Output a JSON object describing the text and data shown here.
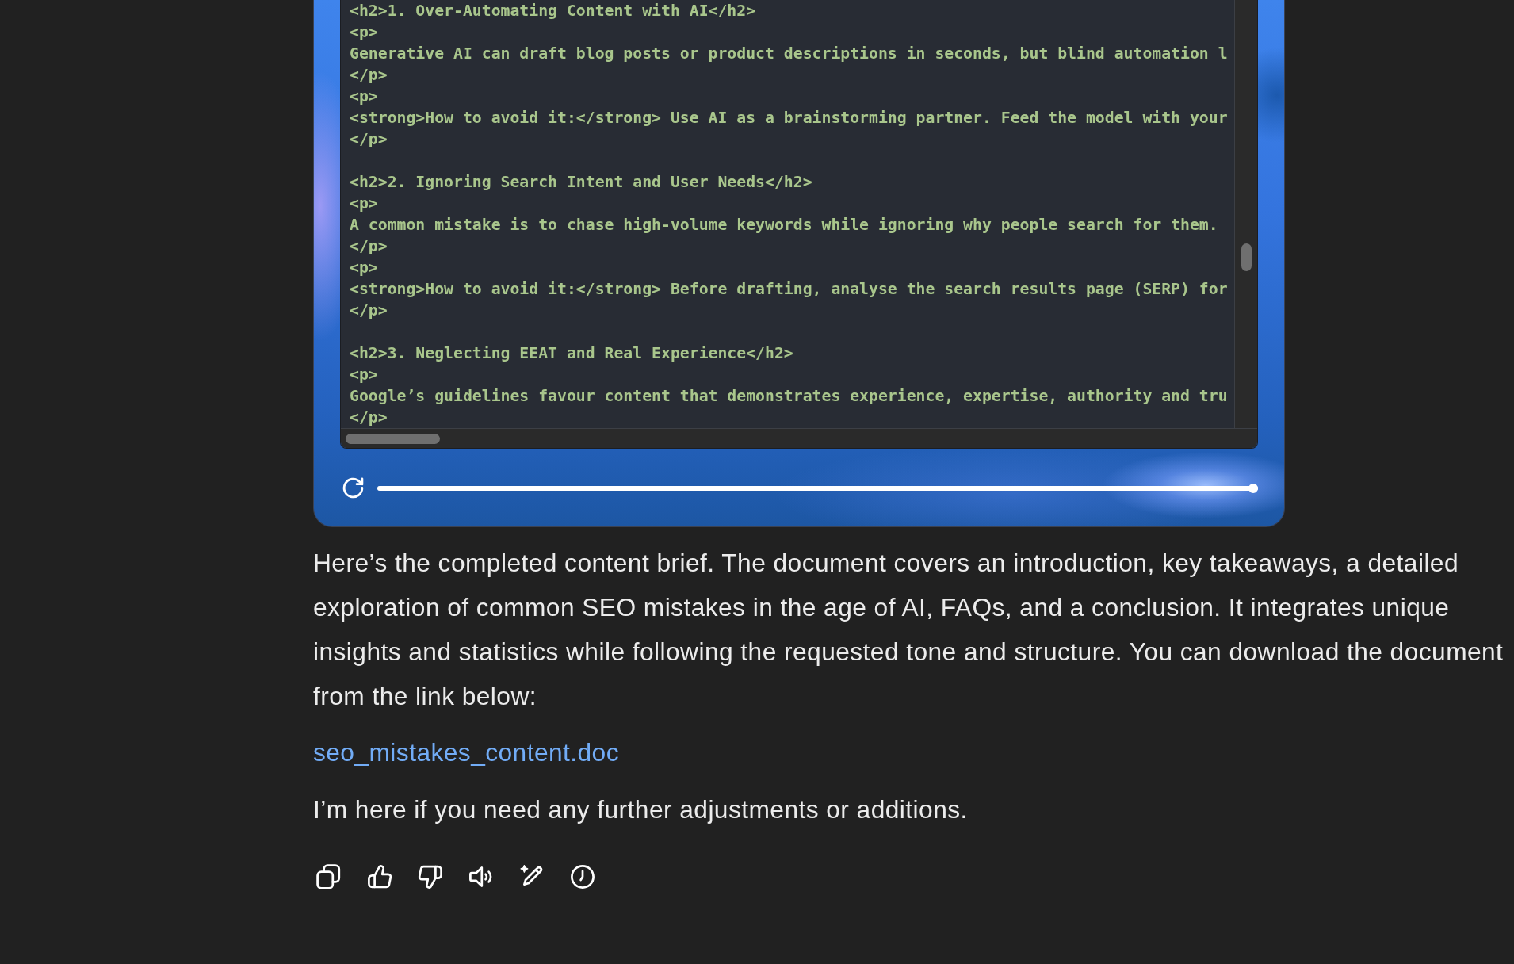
{
  "code_viewer": {
    "blocks": [
      {
        "lines": [
          "<h2>1. Over-Automating Content with AI</h2>",
          "<p>",
          "Generative AI can draft blog posts or product descriptions in seconds, but blind automation l",
          "</p>",
          "<p>",
          "<strong>How to avoid it:</strong> Use AI as a brainstorming partner. Feed the model with your",
          "</p>"
        ]
      },
      {
        "lines": [
          "<h2>2. Ignoring Search Intent and User Needs</h2>",
          "<p>",
          "A common mistake is to chase high-volume keywords while ignoring why people search for them.",
          "</p>",
          "<p>",
          "<strong>How to avoid it:</strong> Before drafting, analyse the search results page (SERP) for",
          "</p>"
        ]
      },
      {
        "lines": [
          "<h2>3. Neglecting EEAT and Real Experience</h2>",
          "<p>",
          "Google’s guidelines favour content that demonstrates experience, expertise, authority and tru",
          "</p>"
        ]
      }
    ]
  },
  "player": {
    "level": 1
  },
  "message": {
    "paragraph_lines": [
      "Here’s the completed content brief. The document covers an introduction, key takeaways, a detailed",
      "exploration of common SEO mistakes in the age of AI, FAQs, and a conclusion. It integrates unique",
      "insights and statistics while following the requested tone and structure. You can download the document",
      "from the link below:"
    ],
    "link": "seo_mistakes_content.doc",
    "closing": "I’m here if you need any further adjustments or additions."
  }
}
